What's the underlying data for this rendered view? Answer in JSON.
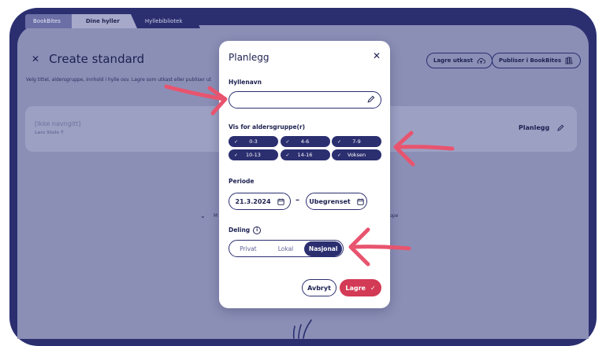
{
  "tabs": [
    "BookBites",
    "Dine hyller",
    "Hyllebibliotek"
  ],
  "background": {
    "title": "Create standard",
    "subtitle": "Velg tittel, aldersgruppe, innhold i hylle osv. Lagre som utkast eller publiser ut",
    "draft_button": "Lagre utkast",
    "publish_button": "Publiser i BookBites",
    "card_name": "[Ikke navngitt]",
    "card_author": "Lars Stole T",
    "card_action": "Planlegg",
    "collapsed_prefix": "M",
    "collapsed_suffix": "ppe"
  },
  "modal": {
    "title": "Planlegg",
    "shelf_label": "Hyllenavn",
    "shelf_value": "",
    "age_label": "Vis for aldersgruppe(r)",
    "age_groups": [
      "0-3",
      "4-6",
      "7-9",
      "10-13",
      "14-16",
      "Voksen"
    ],
    "period_label": "Periode",
    "start_date": "21.3.2024",
    "end_date": "Ubegrenset",
    "sharing_label": "Deling",
    "sharing_options": [
      "Privat",
      "Lokal",
      "Nasjonal"
    ],
    "sharing_selected": "Nasjonal",
    "cancel_label": "Avbryt",
    "save_label": "Lagre"
  },
  "colors": {
    "navy": "#2b2f70",
    "accent": "#d23a55",
    "arrow": "#e8546e"
  }
}
